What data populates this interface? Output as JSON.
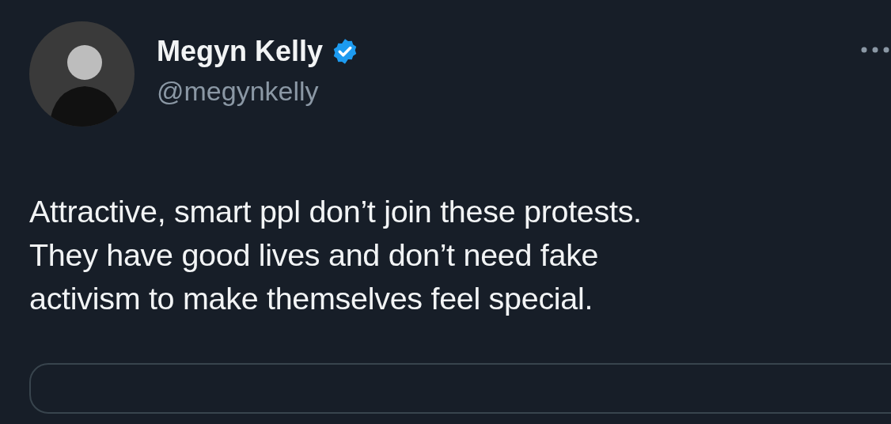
{
  "author": {
    "name": "Megyn Kelly",
    "handle": "@megynkelly",
    "verified": true
  },
  "tweet": {
    "text": "Attractive, smart ppl don’t join these protests.\nThey have good lives and don’t need fake\nactivism to make themselves feel special."
  }
}
